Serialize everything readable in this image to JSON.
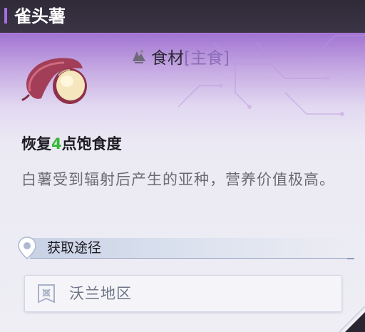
{
  "item": {
    "name": "雀头薯",
    "category_label": "食材",
    "category_sub": "[主食]",
    "effect_prefix": "恢复",
    "effect_value": "4",
    "effect_suffix": "点饱食度",
    "description": "白薯受到辐射后产生的亚种，营养价值极高。"
  },
  "source": {
    "header": "获取途径",
    "location": "沃兰地区"
  },
  "icons": {
    "item": "sweet-potato-icon",
    "category": "ingredient-icon",
    "source": "location-pin-icon",
    "location": "region-map-icon"
  },
  "colors": {
    "accent": "#a46ee0",
    "effect_value": "#36b837",
    "category_sub": "#8d6cb8"
  }
}
